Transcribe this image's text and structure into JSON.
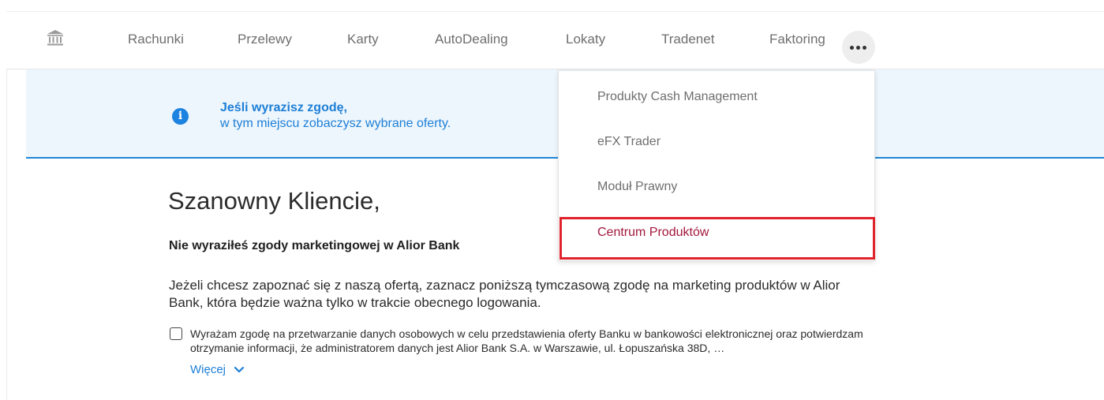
{
  "nav": {
    "items": [
      {
        "label": "Rachunki"
      },
      {
        "label": "Przelewy"
      },
      {
        "label": "Karty"
      },
      {
        "label": "AutoDealing"
      },
      {
        "label": "Lokaty"
      },
      {
        "label": "Tradenet"
      },
      {
        "label": "Faktoring"
      }
    ],
    "home_icon": "bank-icon",
    "more_icon": "more-horizontal-icon"
  },
  "banner": {
    "title": "Jeśli wyrazisz zgodę,",
    "text": "w tym miejscu zobaczysz wybrane oferty.",
    "icon": "info-icon",
    "accent_color": "#1d83e0"
  },
  "dropdown": {
    "items": [
      {
        "label": "Produkty Cash Management"
      },
      {
        "label": "eFX Trader"
      },
      {
        "label": "Moduł Prawny"
      },
      {
        "label": "Centrum Produktów"
      }
    ],
    "highlight_color": "#e0222b",
    "active_item_color": "#a3173f"
  },
  "main": {
    "heading": "Szanowny Kliencie,",
    "subheading": "Nie wyraziłeś zgody marketingowej w Alior Bank",
    "paragraph": "Jeżeli chcesz zapoznać się z naszą ofertą, zaznacz poniższą tymczasową zgodę na marketing produktów w Alior Bank, która będzie ważna tylko w trakcie obecnego logowania.",
    "consent": {
      "checked": false,
      "text": "Wyrażam zgodę na przetwarzanie danych osobowych w celu przedstawienia oferty Banku w bankowości elektronicznej oraz potwierdzam otrzymanie informacji, że administratorem danych jest Alior Bank S.A. w Warszawie, ul. Łopuszańska 38D, …"
    },
    "more_link": "Więcej"
  }
}
